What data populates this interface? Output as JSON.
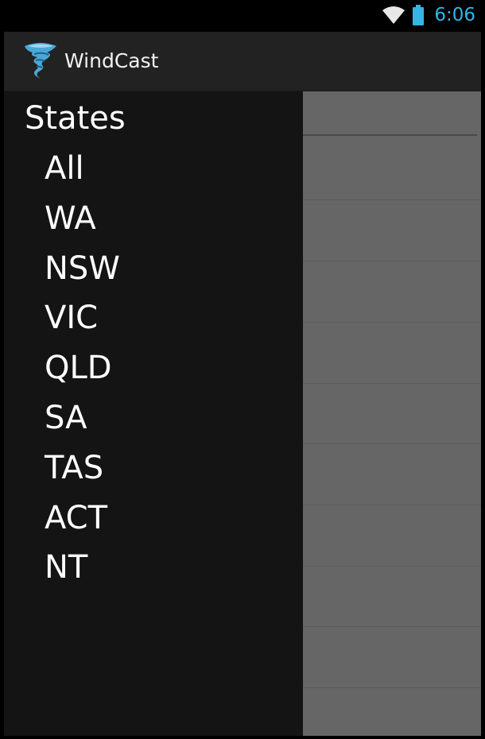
{
  "status_bar": {
    "time": "6:06",
    "wifi_icon": "wifi-icon",
    "battery_icon": "battery-icon",
    "accent_color": "#33b5e5"
  },
  "action_bar": {
    "app_icon": "tornado-icon",
    "title": "WindCast"
  },
  "drawer": {
    "header": "States",
    "items": [
      {
        "label": "All"
      },
      {
        "label": "WA"
      },
      {
        "label": "NSW"
      },
      {
        "label": "VIC"
      },
      {
        "label": "QLD"
      },
      {
        "label": "SA"
      },
      {
        "label": "TAS"
      },
      {
        "label": "ACT"
      },
      {
        "label": "NT"
      }
    ]
  }
}
